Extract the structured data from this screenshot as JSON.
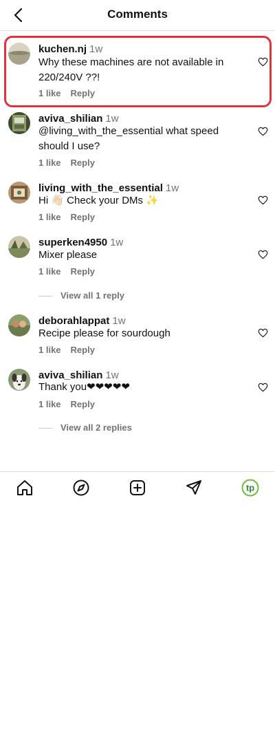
{
  "header": {
    "title": "Comments",
    "back_icon": "chevron-left-icon"
  },
  "comments": [
    {
      "username": "kuchen.nj",
      "time": "1w",
      "text": "Why these machines are not available in 220/240V ??!",
      "likes": "1 like",
      "reply": "Reply"
    },
    {
      "username": "aviva_shilian",
      "time": "1w",
      "text": "@living_with_the_essential what speed should I use?",
      "likes": "1 like",
      "reply": "Reply"
    },
    {
      "username": "living_with_the_essential",
      "time": "1w",
      "text": "Hi 👋🏻 Check your DMs ✨",
      "likes": "1 like",
      "reply": "Reply"
    },
    {
      "username": "superken4950",
      "time": "1w",
      "text": "Mixer please",
      "likes": "1 like",
      "reply": "Reply",
      "view_replies": "View all 1 reply"
    },
    {
      "username": "deborahlappat",
      "time": "1w",
      "text": "Recipe please for sourdough",
      "likes": "1 like",
      "reply": "Reply"
    },
    {
      "username": "aviva_shilian",
      "time": "1w",
      "text": "Thank you❤❤❤❤❤",
      "likes": "1 like",
      "reply": "Reply",
      "view_replies": "View all 2 replies"
    }
  ],
  "nav": {
    "items": [
      "home-icon",
      "explore-compass-icon",
      "create-plus-icon",
      "direct-send-icon",
      "profile-avatar-icon"
    ],
    "profile_initials": "tp"
  },
  "colors": {
    "highlight": "#e0323c",
    "secondary_text": "#737373",
    "profile_accent": "#6bbf3a"
  }
}
